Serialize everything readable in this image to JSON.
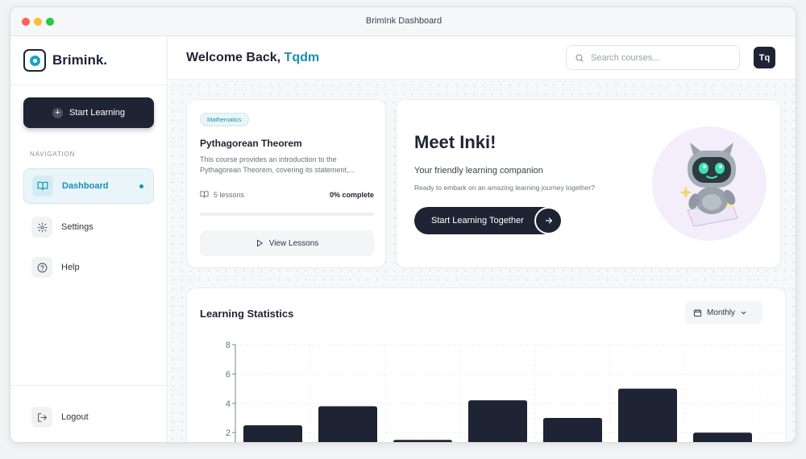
{
  "window": {
    "title": "BrimInk Dashboard"
  },
  "sidebar": {
    "brand": "Brimink.",
    "start_button": "Start Learning",
    "nav_label": "NAVIGATION",
    "items": [
      {
        "label": "Dashboard",
        "icon": "book-open-icon",
        "active": true
      },
      {
        "label": "Settings",
        "icon": "gear-icon",
        "active": false
      },
      {
        "label": "Help",
        "icon": "help-circle-icon",
        "active": false
      }
    ],
    "logout": "Logout"
  },
  "header": {
    "welcome": "Welcome Back,",
    "user_name": "Tqdm",
    "search_placeholder": "Search courses...",
    "avatar": "Tq"
  },
  "course": {
    "tag": "Mathematics",
    "title": "Pythagorean Theorem",
    "description": "This course provides an introduction to the Pythagorean Theorem, covering its statement,...",
    "lessons": "5 lessons",
    "complete": "0% complete",
    "progress": 0,
    "view_button": "View Lessons"
  },
  "inki": {
    "title": "Meet Inki!",
    "subtitle": "Your friendly learning companion",
    "description": "Ready to embark on an amazing learning journey together?",
    "button": "Start Learning Together"
  },
  "stats": {
    "title": "Learning Statistics",
    "period": "Monthly"
  },
  "colors": {
    "primary_dark": "#1e2433",
    "accent": "#1a8fb0",
    "background": "#f7f8fa"
  },
  "chart_data": {
    "type": "bar",
    "y_ticks": [
      "8",
      "6",
      "4",
      "2"
    ],
    "ylim": [
      0,
      8
    ],
    "values": [
      2.5,
      3.8,
      1.5,
      4.2,
      3.0,
      5.0,
      2.0
    ],
    "grid": true
  }
}
